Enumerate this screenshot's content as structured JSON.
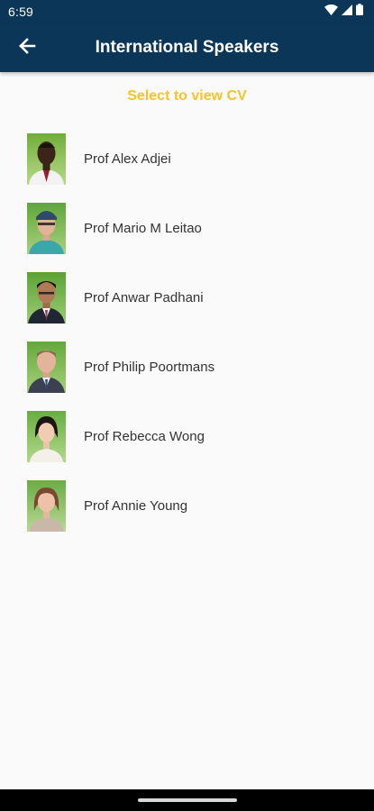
{
  "status_bar": {
    "time": "6:59",
    "icons": [
      "wifi-icon",
      "signal-icon",
      "battery-icon"
    ]
  },
  "app_bar": {
    "back_icon": "arrow-left-icon",
    "title": "International Speakers"
  },
  "subtitle": "Select to view CV",
  "colors": {
    "app_bar": "#0b3658",
    "accent": "#f7c325",
    "background": "#fafafa",
    "text": "#333333"
  },
  "speakers": [
    {
      "name": "Prof Alex Adjei"
    },
    {
      "name": "Prof Mario M Leitao"
    },
    {
      "name": "Prof Anwar Padhani"
    },
    {
      "name": "Prof Philip Poortmans"
    },
    {
      "name": "Prof Rebecca Wong"
    },
    {
      "name": "Prof Annie Young"
    }
  ]
}
